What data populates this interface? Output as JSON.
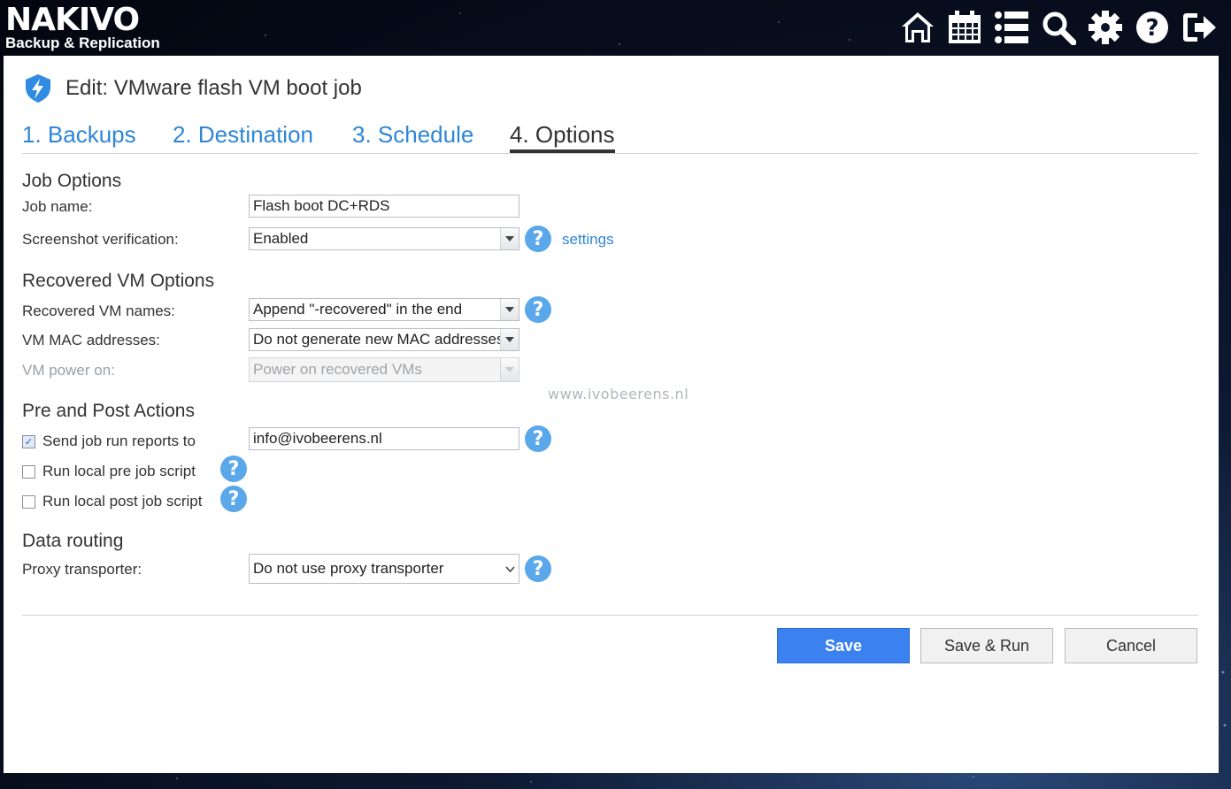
{
  "app": {
    "logo_main": "NAKIVO",
    "logo_sub": "Backup & Replication",
    "top_icons": [
      "home-icon",
      "calendar-icon",
      "list-icon",
      "search-icon",
      "gear-icon",
      "help-icon",
      "logout-icon"
    ]
  },
  "page": {
    "title": "Edit: VMware flash VM boot job",
    "title_icon": "flash-shield-icon"
  },
  "tabs": [
    {
      "label": "1. Backups",
      "active": false
    },
    {
      "label": "2. Destination",
      "active": false
    },
    {
      "label": "3. Schedule",
      "active": false
    },
    {
      "label": "4. Options",
      "active": true
    }
  ],
  "job_options": {
    "heading": "Job Options",
    "job_name_label": "Job name:",
    "job_name_value": "Flash boot DC+RDS",
    "screenshot_label": "Screenshot verification:",
    "screenshot_value": "Enabled",
    "settings_link": "settings"
  },
  "recovered_vm_options": {
    "heading": "Recovered VM Options",
    "names_label": "Recovered VM names:",
    "names_value": "Append \"-recovered\" in the end",
    "mac_label": "VM MAC addresses:",
    "mac_value": "Do not generate new MAC addresses",
    "power_label": "VM power on:",
    "power_value": "Power on recovered VMs"
  },
  "watermark": "www.ivobeerens.nl",
  "pre_post": {
    "heading": "Pre and Post Actions",
    "send_reports_label": "Send job run reports to",
    "send_reports_checked": true,
    "send_reports_value": "info@ivobeerens.nl",
    "pre_script_label": "Run local pre job script",
    "pre_script_checked": false,
    "post_script_label": "Run local post job script",
    "post_script_checked": false
  },
  "data_routing": {
    "heading": "Data routing",
    "proxy_label": "Proxy transporter:",
    "proxy_value": "Do not use proxy transporter"
  },
  "buttons": {
    "save": "Save",
    "save_run": "Save & Run",
    "cancel": "Cancel"
  },
  "colors": {
    "accent": "#3b82f0",
    "link": "#2e86d6",
    "help": "#5aa7ea"
  }
}
